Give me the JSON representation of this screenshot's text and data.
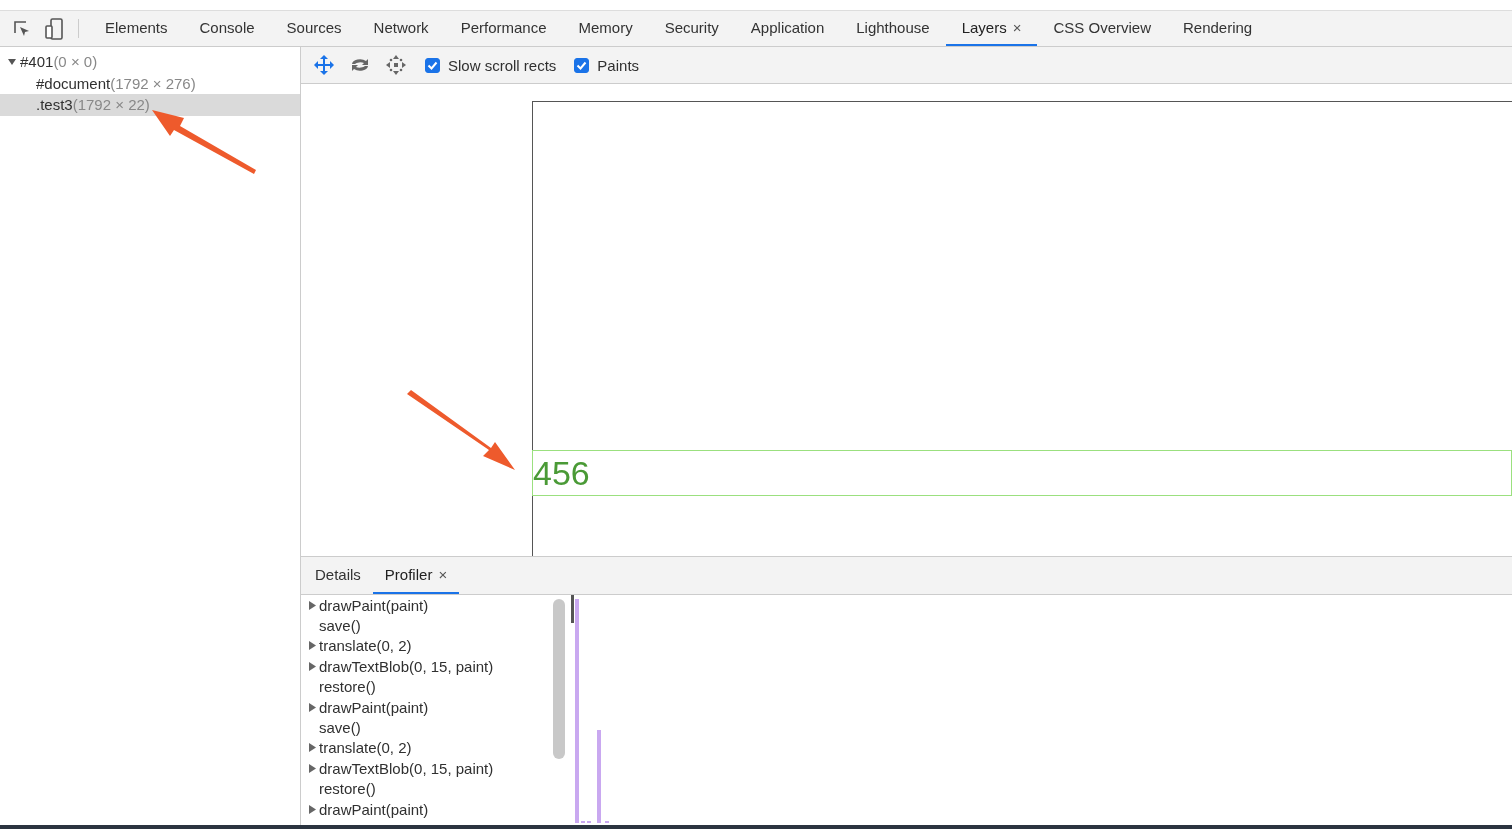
{
  "main_tabs": [
    {
      "label": "Elements",
      "selected": false,
      "closable": false
    },
    {
      "label": "Console",
      "selected": false,
      "closable": false
    },
    {
      "label": "Sources",
      "selected": false,
      "closable": false
    },
    {
      "label": "Network",
      "selected": false,
      "closable": false
    },
    {
      "label": "Performance",
      "selected": false,
      "closable": false
    },
    {
      "label": "Memory",
      "selected": false,
      "closable": false
    },
    {
      "label": "Security",
      "selected": false,
      "closable": false
    },
    {
      "label": "Application",
      "selected": false,
      "closable": false
    },
    {
      "label": "Lighthouse",
      "selected": false,
      "closable": false
    },
    {
      "label": "Layers",
      "selected": true,
      "closable": true,
      "close": "×"
    },
    {
      "label": "CSS Overview",
      "selected": false,
      "closable": false
    },
    {
      "label": "Rendering",
      "selected": false,
      "closable": false
    }
  ],
  "layer_tree": [
    {
      "name": "#401",
      "dims": "(0 × 0)",
      "selected": false,
      "expanded": true,
      "children": [
        {
          "name": "#document",
          "dims": "(1792 × 276)",
          "selected": false
        },
        {
          "name": ".test3",
          "dims": "(1792 × 22)",
          "selected": true
        }
      ]
    }
  ],
  "toolbar": {
    "options": [
      {
        "label": "Slow scroll rects",
        "checked": true
      },
      {
        "label": "Paints",
        "checked": true
      }
    ]
  },
  "viewport": {
    "layer_text": "456"
  },
  "bottom_tabs": [
    {
      "label": "Details",
      "selected": false,
      "closable": false
    },
    {
      "label": "Profiler",
      "selected": true,
      "closable": true,
      "close": "×"
    }
  ],
  "profiler_commands": [
    {
      "text": "drawPaint(paint)",
      "expandable": true
    },
    {
      "text": "save()",
      "expandable": false
    },
    {
      "text": "translate(0, 2)",
      "expandable": true
    },
    {
      "text": "drawTextBlob(0, 15, paint)",
      "expandable": true
    },
    {
      "text": "restore()",
      "expandable": false
    },
    {
      "text": "drawPaint(paint)",
      "expandable": true
    },
    {
      "text": "save()",
      "expandable": false
    },
    {
      "text": "translate(0, 2)",
      "expandable": true
    },
    {
      "text": "drawTextBlob(0, 15, paint)",
      "expandable": true
    },
    {
      "text": "restore()",
      "expandable": false
    },
    {
      "text": "drawPaint(paint)",
      "expandable": true
    }
  ]
}
